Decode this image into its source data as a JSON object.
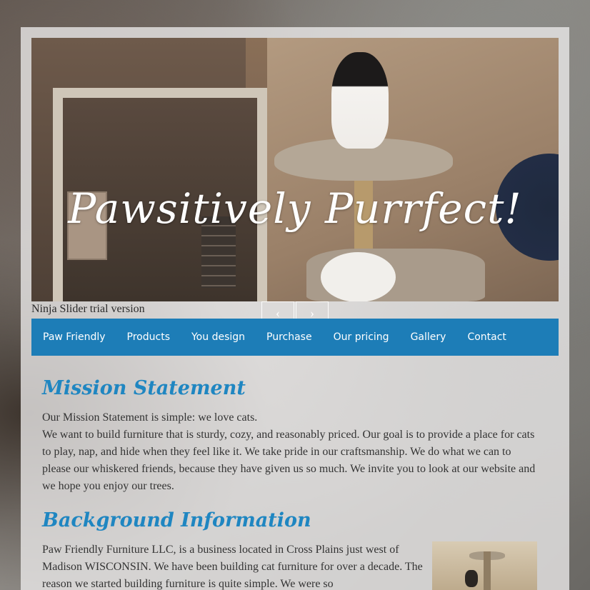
{
  "hero": {
    "title": "Pawsitively Purrfect!",
    "trial_text": "Ninja Slider trial version",
    "prev_glyph": "‹",
    "next_glyph": "›"
  },
  "nav": {
    "items": [
      {
        "label": "Paw Friendly"
      },
      {
        "label": "Products"
      },
      {
        "label": "You design"
      },
      {
        "label": "Purchase"
      },
      {
        "label": "Our pricing"
      },
      {
        "label": "Gallery"
      },
      {
        "label": "Contact"
      }
    ]
  },
  "mission": {
    "heading": "Mission Statement",
    "intro": "Our Mission Statement is simple: we love cats.",
    "body": "We want to build furniture that is sturdy, cozy, and reasonably priced. Our goal is to provide a place for cats to play, nap, and hide when they feel like it. We take pride in our craftsmanship. We do what we can to please our whiskered friends, because they have given us so much. We invite you to look at our website and we hope you enjoy our trees."
  },
  "background": {
    "heading": "Background Information",
    "body": "Paw Friendly Furniture LLC, is a business located in Cross Plains just west of  Madison WISCONSIN. We have been building cat furniture for over a decade. The reason we started building furniture is quite simple. We were so"
  },
  "colors": {
    "nav_bg": "#1d7db7",
    "heading": "#1f86c1"
  }
}
